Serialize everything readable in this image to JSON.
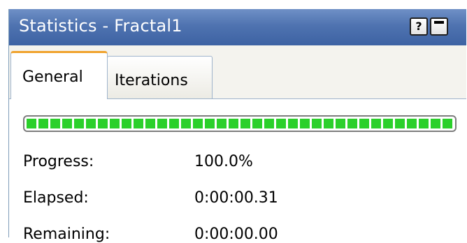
{
  "window": {
    "title": "Statistics - Fractal1",
    "help_glyph": "?",
    "buttons": [
      "help-icon",
      "minimize-icon"
    ]
  },
  "tabs": [
    {
      "label": "General",
      "active": true
    },
    {
      "label": "Iterations",
      "active": false
    }
  ],
  "progress": {
    "fraction": 1.0,
    "color": "#2bd02b"
  },
  "stats": [
    {
      "label": "Progress:",
      "value": "100.0%"
    },
    {
      "label": "Elapsed:",
      "value": "0:00:00.31"
    },
    {
      "label": "Remaining:",
      "value": "0:00:00.00"
    }
  ],
  "colors": {
    "titlebar": "#4f73b0",
    "active_tab_accent": "#f0a22c"
  }
}
